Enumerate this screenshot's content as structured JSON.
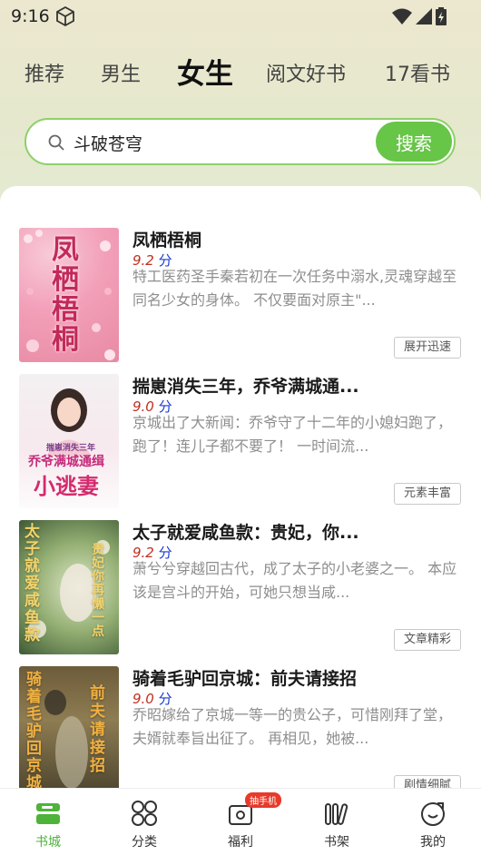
{
  "status_bar": {
    "time": "9:16"
  },
  "top_tabs": [
    {
      "label": "推荐",
      "active": false
    },
    {
      "label": "男生",
      "active": false
    },
    {
      "label": "女生",
      "active": true
    },
    {
      "label": "阅文好书",
      "active": false
    },
    {
      "label": "17看书",
      "active": false
    }
  ],
  "search": {
    "value": "斗破苍穹",
    "button_label": "搜索"
  },
  "books": [
    {
      "title": "凤栖梧桐",
      "score": "9.2",
      "score_unit": "分",
      "description": "特工医药圣手秦若初在一次任务中溺水,灵魂穿越至同名少女的身体。 不仅要面对原主\"...",
      "tag": "展开迅速",
      "cover_text": "凤栖梧桐"
    },
    {
      "title": "揣崽消失三年，乔爷满城通...",
      "score": "9.0",
      "score_unit": "分",
      "description": "京城出了大新闻：乔爷守了十二年的小媳妇跑了，跑了！连儿子都不要了！ 一时间流...",
      "tag": "元素丰富",
      "cover_text_small": "揣崽消失三年",
      "cover_text_mid": "乔爷满城通缉",
      "cover_text_big": "小逃妻"
    },
    {
      "title": "太子就爱咸鱼款：贵妃，你...",
      "score": "9.2",
      "score_unit": "分",
      "description": "萧兮兮穿越回古代，成了太子的小老婆之一。 本应该是宫斗的开始，可她只想当咸...",
      "tag": "文章精彩",
      "cover_text_left": "太子就爱咸鱼款",
      "cover_text_right": "贵妃你再懒一点"
    },
    {
      "title": "骑着毛驴回京城：前夫请接招",
      "score": "9.0",
      "score_unit": "分",
      "description": "乔昭嫁给了京城一等一的贵公子，可惜刚拜了堂，夫婿就奉旨出征了。 再相见，她被...",
      "tag": "剧情细腻",
      "cover_text_left": "骑着毛驴回京城",
      "cover_text_right": "前夫请接招"
    }
  ],
  "bottom_nav": [
    {
      "label": "书城",
      "icon": "bookstore-icon",
      "active": true
    },
    {
      "label": "分类",
      "icon": "category-icon",
      "active": false
    },
    {
      "label": "福利",
      "icon": "gift-icon",
      "active": false,
      "badge": "抽手机"
    },
    {
      "label": "书架",
      "icon": "bookshelf-icon",
      "active": false
    },
    {
      "label": "我的",
      "icon": "profile-icon",
      "active": false
    }
  ],
  "colors": {
    "accent": "#67c548",
    "score": "#c03020",
    "score_unit": "#1a3ad0"
  }
}
